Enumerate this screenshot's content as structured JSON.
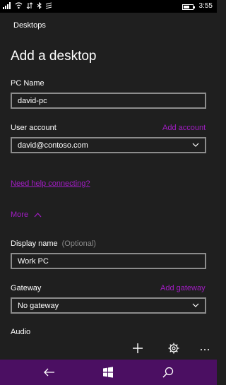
{
  "status_bar": {
    "time": "3:55",
    "battery_level": 0.7,
    "icons": [
      "signal-icon",
      "wifi-icon",
      "data-icon",
      "bluetooth-icon",
      "location-icon"
    ]
  },
  "app": {
    "title": "Desktops"
  },
  "page": {
    "title": "Add a desktop"
  },
  "pc_name": {
    "label": "PC Name",
    "value": "david-pc"
  },
  "user_account": {
    "label": "User account",
    "add_link": "Add account",
    "value": "david@contoso.com"
  },
  "help_link": "Need help connecting?",
  "more_toggle": "More",
  "display_name": {
    "label": "Display name",
    "optional": "(Optional)",
    "value": "Work PC"
  },
  "gateway": {
    "label": "Gateway",
    "add_link": "Add gateway",
    "value": "No gateway"
  },
  "audio": {
    "label": "Audio"
  },
  "app_bar": {
    "icons": [
      "add-icon",
      "settings-icon",
      "more-icon"
    ]
  },
  "nav_bar": {
    "icons": [
      "back-icon",
      "windows-icon",
      "search-icon"
    ]
  },
  "colors": {
    "accent": "#a21dc4",
    "nav_bar": "#4b0f62",
    "background": "#1f1f1f",
    "field_border": "#8c8c8c"
  }
}
